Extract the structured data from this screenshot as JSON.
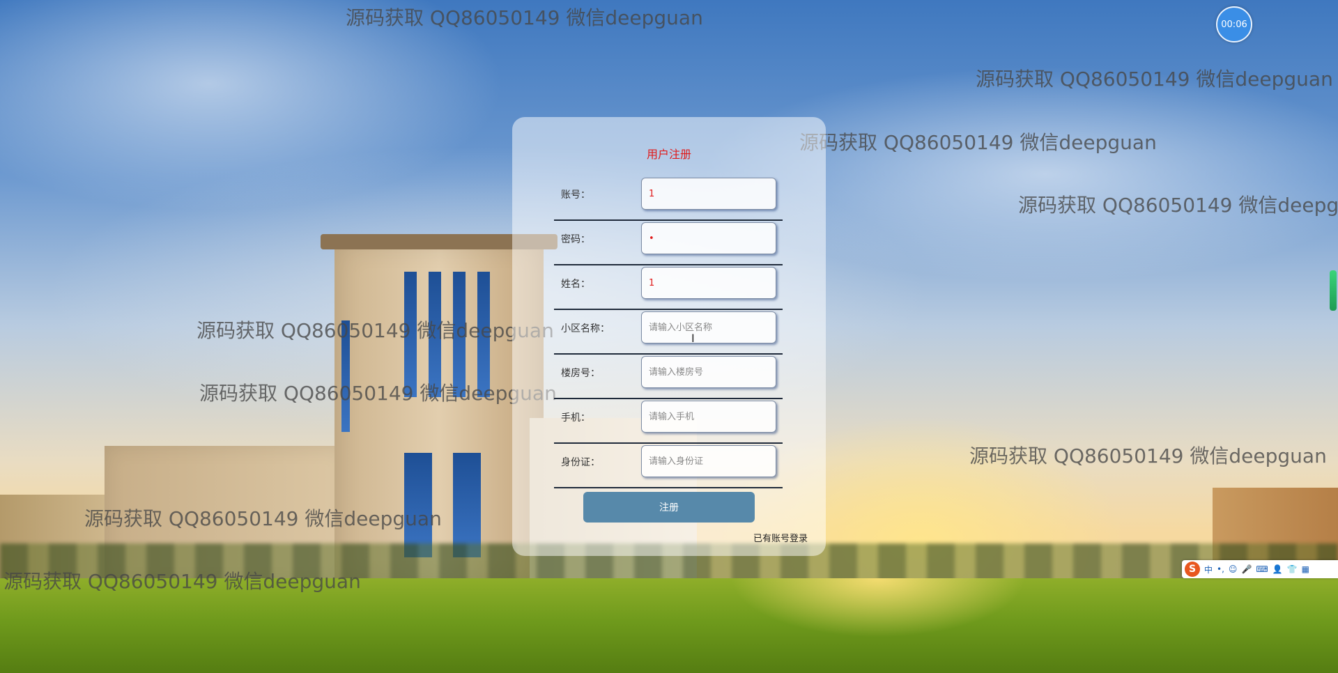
{
  "watermark": {
    "text": "源码获取 QQ86050149 微信deepguan"
  },
  "timer": {
    "label": "00:06"
  },
  "register": {
    "title": "用户注册",
    "fields": [
      {
        "label": "账号：",
        "value": "1",
        "placeholder": ""
      },
      {
        "label": "密码：",
        "value": "•",
        "placeholder": ""
      },
      {
        "label": "姓名：",
        "value": "1",
        "placeholder": ""
      },
      {
        "label": "小区名称：",
        "value": "",
        "placeholder": "请输入小区名称"
      },
      {
        "label": "楼房号：",
        "value": "",
        "placeholder": "请输入楼房号"
      },
      {
        "label": "手机：",
        "value": "",
        "placeholder": "请输入手机"
      },
      {
        "label": "身份证：",
        "value": "",
        "placeholder": "请输入身份证"
      }
    ],
    "submit_label": "注册",
    "login_link": "已有账号登录"
  },
  "ime": {
    "logo": "S",
    "items": [
      "中",
      "•,",
      "☺",
      "🎤",
      "⌨",
      "👤",
      "👕",
      "▦"
    ]
  }
}
